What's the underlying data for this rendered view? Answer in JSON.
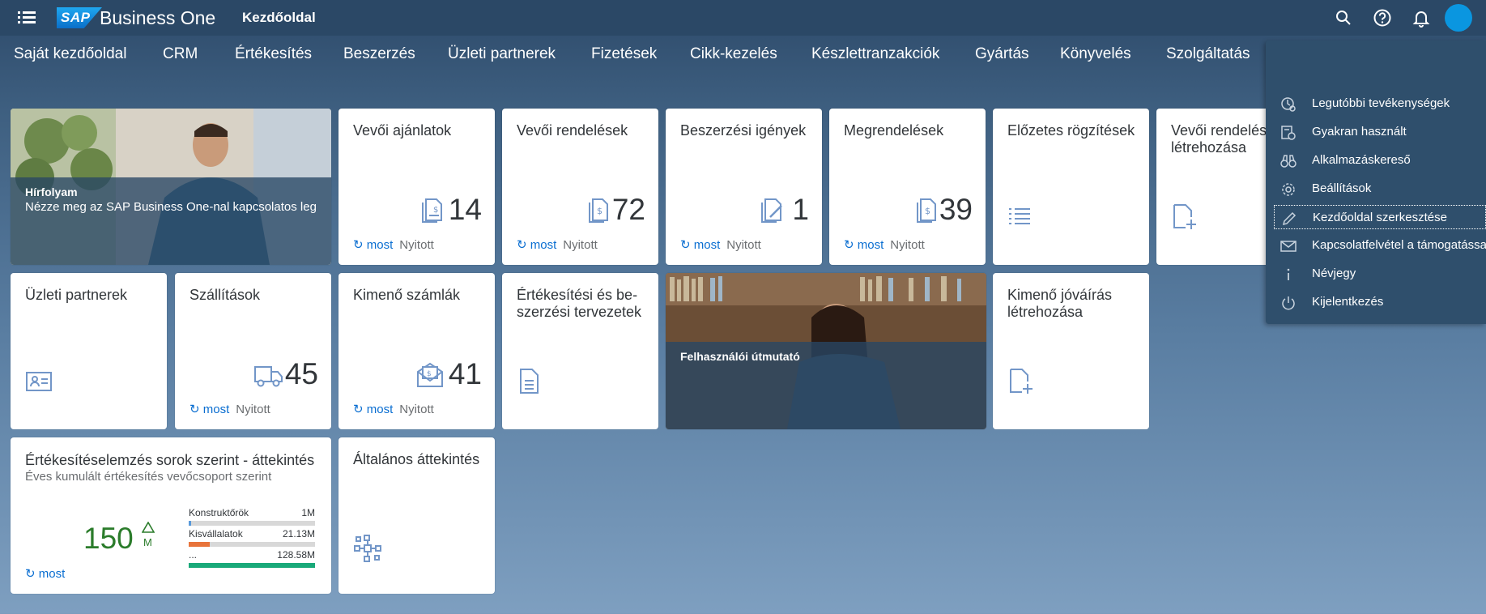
{
  "shell": {
    "product": "Business One",
    "logo_text": "SAP",
    "page_title": "Kezdőoldal",
    "accent": "#0a96e0",
    "icons": [
      "menu-icon",
      "search-icon",
      "help-icon",
      "bell-icon",
      "avatar"
    ]
  },
  "nav": {
    "items": [
      "Saját kezdőoldal",
      "CRM",
      "Értékesítés",
      "Beszerzés",
      "Üzleti partnerek",
      "Fizetések",
      "Cikk-kezelés",
      "Készlettranzakciók",
      "Gyártás",
      "Könyvelés",
      "Szolgáltatás"
    ]
  },
  "tiles": {
    "news": {
      "title": "Hírfolyam",
      "subtitle": "Nézze meg az SAP Business One-nal kapcsolatos leg"
    },
    "quotes": {
      "title": "Vevői ajánlatok",
      "value": "14",
      "refresh": "most",
      "status": "Nyitott",
      "icon": "quote-icon"
    },
    "orders": {
      "title": "Vevői rendelések",
      "value": "72",
      "refresh": "most",
      "status": "Nyitott",
      "icon": "order-icon"
    },
    "purchase_requests": {
      "title": "Beszerzési igények",
      "value": "1",
      "refresh": "most",
      "status": "Nyitott",
      "icon": "request-icon"
    },
    "purchase_orders": {
      "title": "Megrendelések",
      "value": "39",
      "refresh": "most",
      "status": "Nyitott",
      "icon": "po-icon"
    },
    "drafts": {
      "title": "Előzetes rögzítések",
      "icon": "list-icon"
    },
    "create_order": {
      "title": "Vevői rendelés létrehozása",
      "icon": "create-doc-icon"
    },
    "business_partners": {
      "title": "Üzleti partnerek",
      "icon": "contact-card-icon"
    },
    "deliveries": {
      "title": "Szállítások",
      "value": "45",
      "refresh": "most",
      "status": "Nyitott",
      "icon": "truck-icon"
    },
    "invoices": {
      "title": "Kimenő számlák",
      "value": "41",
      "refresh": "most",
      "status": "Nyitott",
      "icon": "invoice-icon"
    },
    "plans": {
      "title": "Értékesítési és be-szerzési tervezetek",
      "icon": "document-icon"
    },
    "user_guide": {
      "title": "Felhasználói útmutató"
    },
    "credit_memo": {
      "title": "Kimenő jóváírás létrehozása",
      "icon": "create-doc-icon"
    },
    "analysis": {
      "title": "Értékesítéselemzés sorok szerint - áttekintés",
      "subtitle": "Éves kumulált értékesítés vevőcsoport szerint",
      "kpi": "150",
      "unit": "M",
      "refresh": "most"
    },
    "overview": {
      "title": "Általános áttekintés",
      "icon": "network-icon"
    }
  },
  "chart_data": {
    "type": "bar",
    "categories": [
      "Konstruktőrök",
      "Kisvállalatok",
      "..."
    ],
    "labels": [
      "1M",
      "21.13M",
      "128.58M"
    ],
    "values": [
      1,
      21.13,
      128.58
    ],
    "colors": [
      "#5899da",
      "#e8743b",
      "#19a979"
    ],
    "xlim": [
      0,
      128.58
    ]
  },
  "user_menu": {
    "items": [
      {
        "label": "Legutóbbi tevékenységek",
        "icon": "recent-activity-icon"
      },
      {
        "label": "Gyakran használt",
        "icon": "frequent-icon"
      },
      {
        "label": "Alkalmazáskereső",
        "icon": "binoculars-icon"
      },
      {
        "label": "Beállítások",
        "icon": "settings-icon"
      },
      {
        "label": "Kezdőoldal szerkesztése",
        "icon": "edit-icon"
      },
      {
        "label": "Kapcsolatfelvétel a támogatással",
        "icon": "email-icon"
      },
      {
        "label": "Névjegy",
        "icon": "info-icon"
      },
      {
        "label": "Kijelentkezés",
        "icon": "logout-icon"
      }
    ]
  }
}
